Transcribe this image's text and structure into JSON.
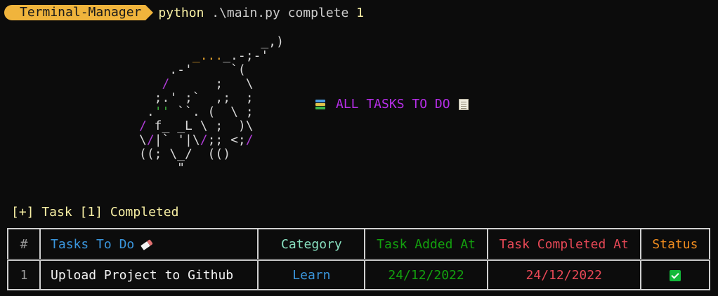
{
  "prompt": {
    "badge": "Terminal-Manager",
    "command": "python",
    "args": " .\\main.py complete ",
    "arg_number": "1"
  },
  "ascii_art": {
    "lines": [
      "                _,)",
      "       _..._.-;-'",
      "    .-'     `(",
      "   /      ;   \\",
      "  ;.' ;`  ,;  ;",
      " .'' ``. (  \\ ;",
      "/ f_ _L \\ ;  )\\",
      "\\/|` '|\\/;; <;/",
      "((; \\_/  (()",
      "     \""
    ]
  },
  "heading": {
    "text": "ALL TASKS TO DO",
    "left_icon": "books-icon",
    "right_icon": "scroll-icon",
    "color": "#b62ee8"
  },
  "status_message": "[+] Task [1] Completed",
  "table": {
    "headers": {
      "num": "#",
      "task": "Tasks To Do",
      "category": "Category",
      "added": "Task Added At",
      "completed": "Task Completed At",
      "status": "Status"
    },
    "rows": [
      {
        "num": "1",
        "task": "Upload Project to Github",
        "category": "Learn",
        "added": "24/12/2022",
        "completed": "24/12/2022",
        "status_icon": "check-mark-icon"
      }
    ]
  },
  "colors": {
    "background": "#0c0c0c",
    "badge": "#f0b43c",
    "blue": "#3a96dd",
    "green": "#13a10e",
    "red": "#e74856",
    "orange": "#f08c1e",
    "yellow": "#f9f1a5"
  }
}
